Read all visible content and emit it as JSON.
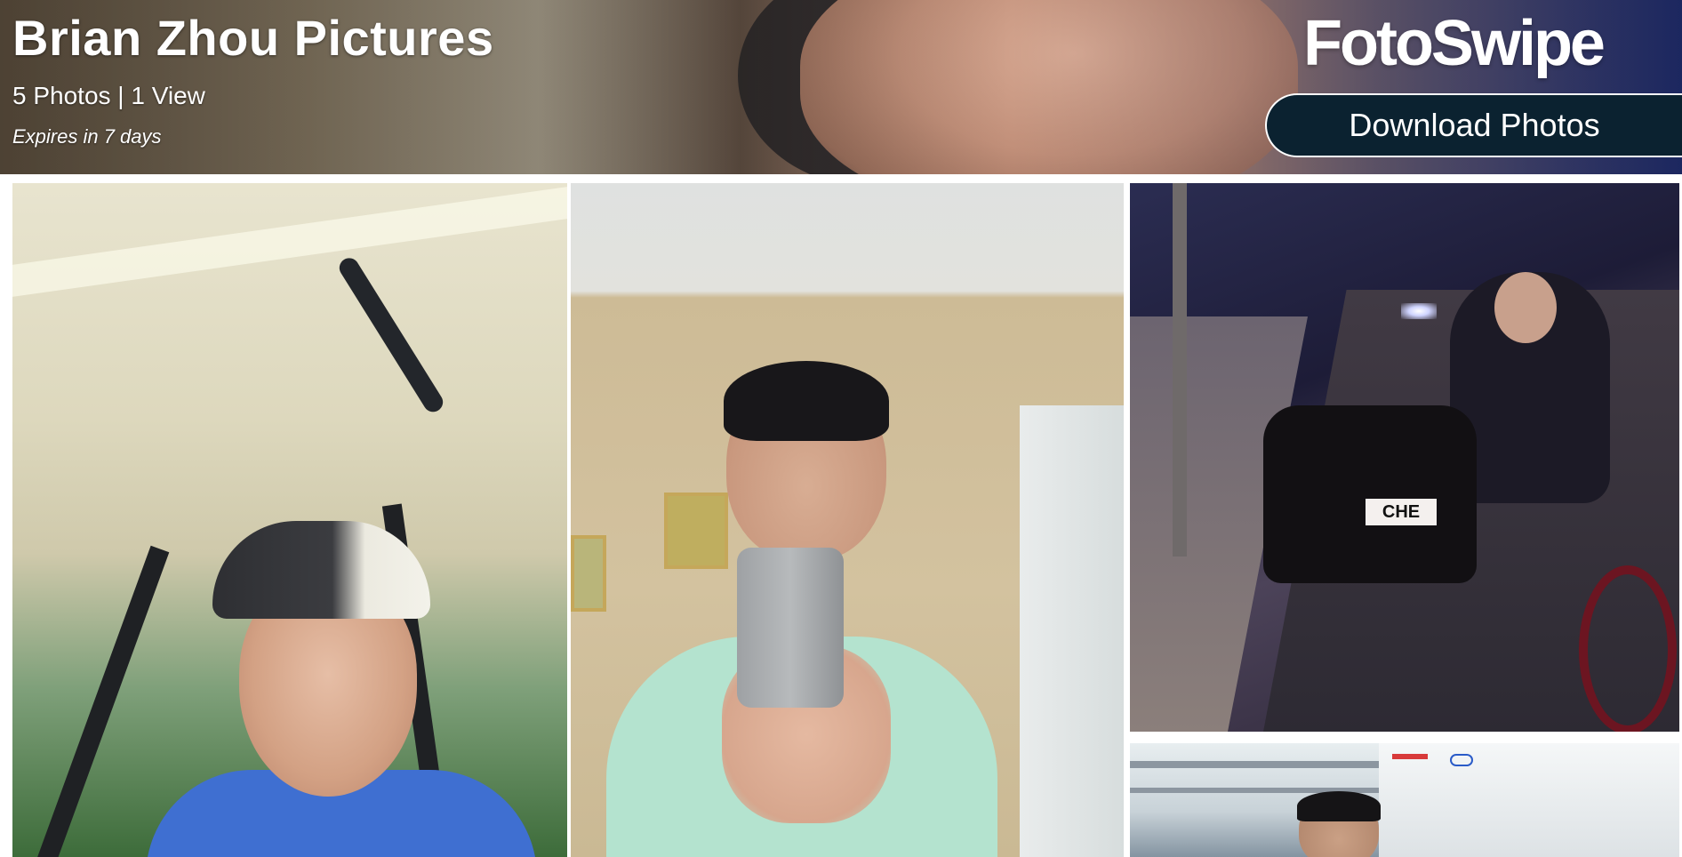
{
  "header": {
    "title": "Brian Zhou Pictures",
    "stats": "5 Photos | 1 View",
    "expires": "Expires in 7 days",
    "logo_text": "FotoSwipe",
    "download_label": "Download Photos"
  },
  "colors": {
    "download_button_bg": "#0b2230",
    "header_text": "#ffffff",
    "page_bg": "#ffffff"
  },
  "gallery": {
    "photos": [
      {
        "subject": "golf-cart-selfie"
      },
      {
        "subject": "mirror-selfie"
      },
      {
        "subject": "motorcycle-sidecar-night",
        "sign_text": "CHE"
      },
      {
        "subject": "office-whiteboard"
      }
    ]
  }
}
